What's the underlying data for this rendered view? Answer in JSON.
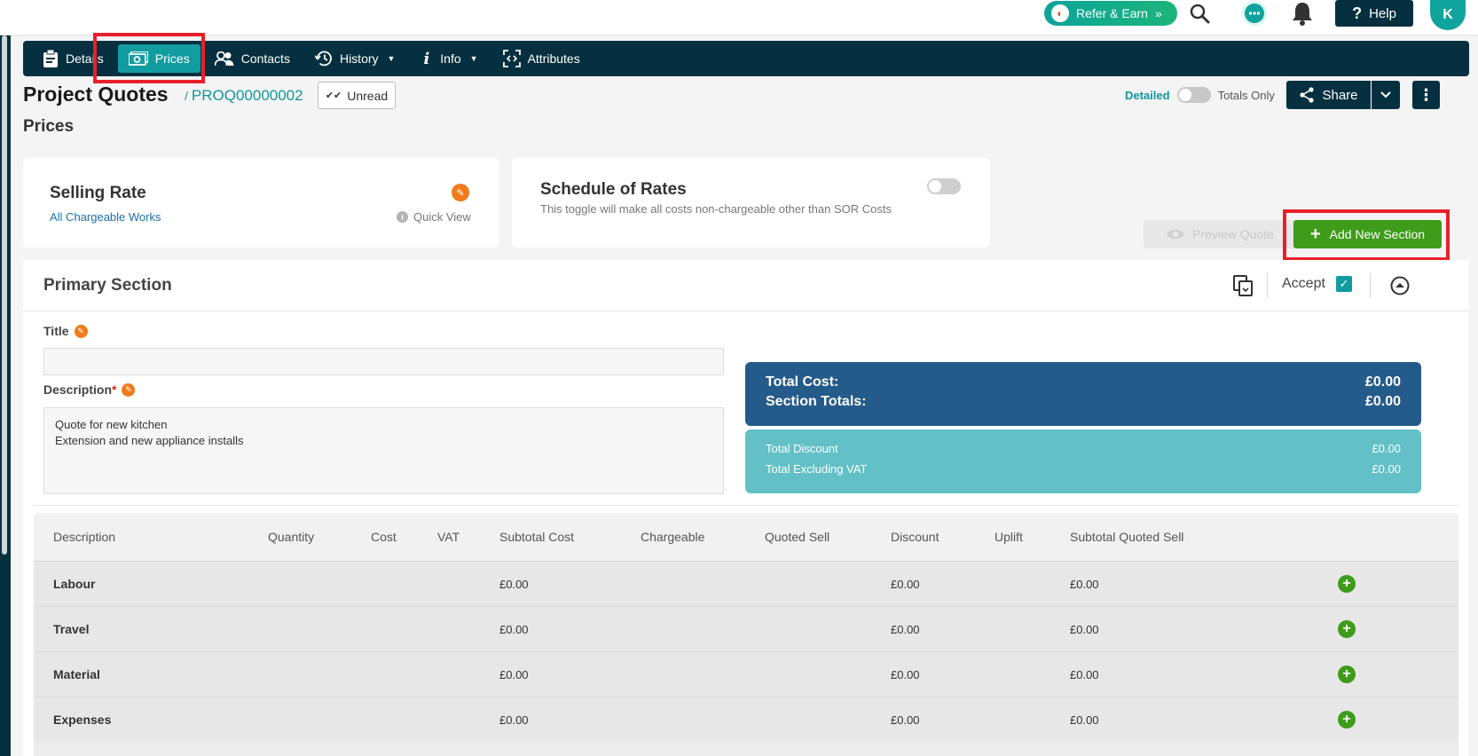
{
  "topbar": {
    "refer_label": "Refer & Earn",
    "refer_chevron": "»",
    "help_label": "Help",
    "avatar_initial": "K"
  },
  "tabs": [
    {
      "label": "Details",
      "icon": "clipboard-icon"
    },
    {
      "label": "Prices",
      "icon": "money-icon",
      "active": true
    },
    {
      "label": "Contacts",
      "icon": "people-icon"
    },
    {
      "label": "History",
      "icon": "history-icon",
      "dropdown": true
    },
    {
      "label": "Info",
      "icon": "info-icon",
      "dropdown": true
    },
    {
      "label": "Attributes",
      "icon": "attributes-icon"
    }
  ],
  "header": {
    "title": "Project Quotes",
    "separator": "/",
    "reference": "PROQ00000002",
    "unread_label": "Unread",
    "section_heading": "Prices",
    "toggle_left": "Detailed",
    "toggle_right": "Totals Only",
    "share_label": "Share"
  },
  "selling_rate": {
    "title": "Selling Rate",
    "subtitle": "All Chargeable Works",
    "quick_view": "Quick View"
  },
  "schedule_of_rates": {
    "title": "Schedule of Rates",
    "description": "This toggle will make all costs non-chargeable other than SOR Costs"
  },
  "actions": {
    "preview_label": "Preview Quote",
    "add_section_label": "Add New Section"
  },
  "primary_section": {
    "title": "Primary Section",
    "accept_label": "Accept",
    "title_label": "Title",
    "title_value": "",
    "description_label": "Description",
    "required_mark": "*",
    "description_value": "Quote for new kitchen\nExtension and new appliance installs"
  },
  "totals": {
    "total_cost_label": "Total Cost:",
    "total_cost_value": "£0.00",
    "section_totals_label": "Section Totals:",
    "section_totals_value": "£0.00",
    "discount_label": "Total Discount",
    "discount_value": "£0.00",
    "excl_vat_label": "Total Excluding VAT",
    "excl_vat_value": "£0.00"
  },
  "table": {
    "headers": [
      "Description",
      "Quantity",
      "Cost",
      "VAT",
      "Subtotal Cost",
      "Chargeable",
      "Quoted Sell",
      "Discount",
      "Uplift",
      "Subtotal Quoted Sell"
    ],
    "rows": [
      {
        "name": "Labour",
        "subtotal_cost": "£0.00",
        "discount": "£0.00",
        "subtotal_quoted_sell": "£0.00"
      },
      {
        "name": "Travel",
        "subtotal_cost": "£0.00",
        "discount": "£0.00",
        "subtotal_quoted_sell": "£0.00"
      },
      {
        "name": "Material",
        "subtotal_cost": "£0.00",
        "discount": "£0.00",
        "subtotal_quoted_sell": "£0.00"
      },
      {
        "name": "Expenses",
        "subtotal_cost": "£0.00",
        "discount": "£0.00",
        "subtotal_quoted_sell": "£0.00"
      }
    ]
  },
  "colors": {
    "nav_bg": "#06303f",
    "accent_teal": "#129ca0",
    "add_green": "#3f9b1a",
    "highlight_red": "#e8202a",
    "totals_dark": "#255b8b",
    "totals_light": "#62c0c6",
    "edit_orange": "#f07b1a"
  }
}
